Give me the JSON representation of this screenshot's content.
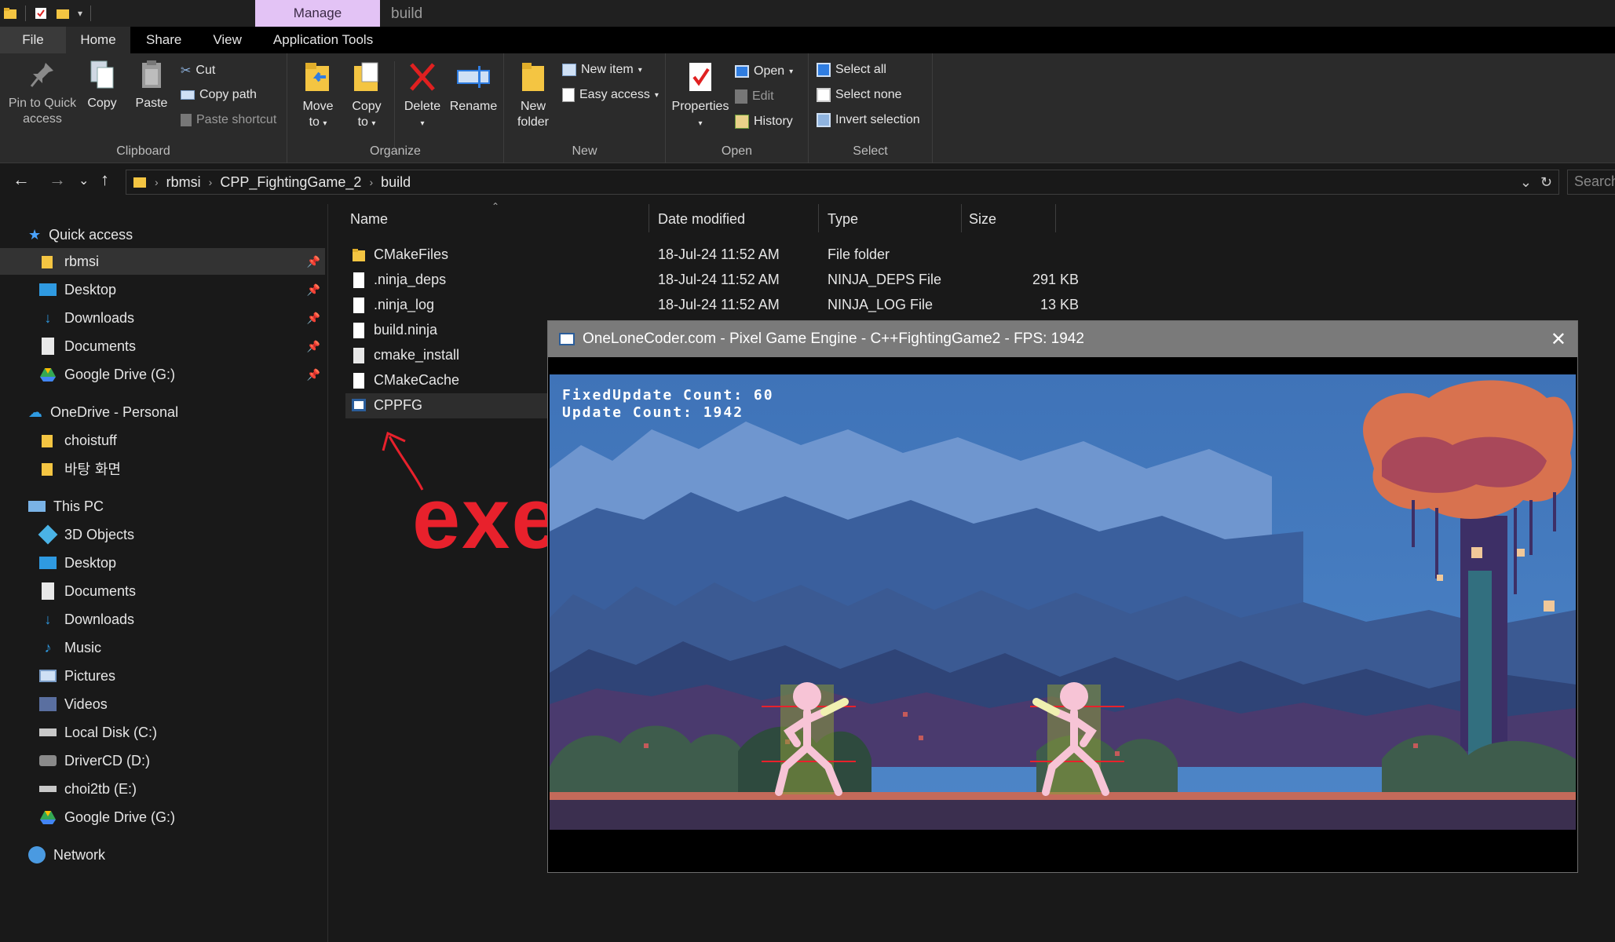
{
  "titlebar": {
    "context_tab": "Manage",
    "folder_name": "build"
  },
  "ribbon_tabs": [
    "File",
    "Home",
    "Share",
    "View",
    "Application Tools"
  ],
  "ribbon": {
    "clipboard": {
      "pin_label": "Pin to Quick access",
      "pin_line1": "Pin to Quick",
      "pin_line2": "access",
      "copy": "Copy",
      "paste": "Paste",
      "cut": "Cut",
      "copy_path": "Copy path",
      "paste_shortcut": "Paste shortcut",
      "group": "Clipboard"
    },
    "organize": {
      "move_line1": "Move",
      "move_line2": "to",
      "copy_line1": "Copy",
      "copy_line2": "to",
      "delete": "Delete",
      "rename": "Rename",
      "group": "Organize"
    },
    "new": {
      "folder_line1": "New",
      "folder_line2": "folder",
      "new_item": "New item",
      "easy_access": "Easy access",
      "group": "New"
    },
    "open": {
      "properties": "Properties",
      "open": "Open",
      "edit": "Edit",
      "history": "History",
      "group": "Open"
    },
    "select": {
      "select_all": "Select all",
      "select_none": "Select none",
      "invert": "Invert selection",
      "group": "Select"
    }
  },
  "address": {
    "crumbs": [
      "rbmsi",
      "CPP_FightingGame_2",
      "build"
    ],
    "search_placeholder": "Search"
  },
  "nav": {
    "quick_access": "Quick access",
    "qa_items": [
      "rbmsi",
      "Desktop",
      "Downloads",
      "Documents",
      "Google Drive (G:)"
    ],
    "onedrive": "OneDrive - Personal",
    "od_items": [
      "choistuff",
      "바탕 화면"
    ],
    "this_pc": "This PC",
    "pc_items": [
      "3D Objects",
      "Desktop",
      "Documents",
      "Downloads",
      "Music",
      "Pictures",
      "Videos",
      "Local Disk (C:)",
      "DriverCD (D:)",
      "choi2tb (E:)",
      "Google Drive (G:)"
    ],
    "network": "Network"
  },
  "columns": {
    "name": "Name",
    "date": "Date modified",
    "type": "Type",
    "size": "Size"
  },
  "files": [
    {
      "name": "CMakeFiles",
      "date": "18-Jul-24 11:52 AM",
      "type": "File folder",
      "size": ""
    },
    {
      "name": ".ninja_deps",
      "date": "18-Jul-24 11:52 AM",
      "type": "NINJA_DEPS File",
      "size": "291 KB"
    },
    {
      "name": ".ninja_log",
      "date": "18-Jul-24 11:52 AM",
      "type": "NINJA_LOG File",
      "size": "13 KB"
    },
    {
      "name": "build.ninja",
      "date": "",
      "type": "",
      "size": ""
    },
    {
      "name": "cmake_install",
      "date": "",
      "type": "",
      "size": ""
    },
    {
      "name": "CMakeCache",
      "date": "",
      "type": "",
      "size": ""
    },
    {
      "name": "CPPFG",
      "date": "",
      "type": "",
      "size": ""
    }
  ],
  "annotation": {
    "text": "exe",
    "color": "#e8212c"
  },
  "game": {
    "title": "OneLoneCoder.com - Pixel Game Engine - C++FightingGame2 - FPS: 1942",
    "hud_line1": "FixedUpdate Count: 60",
    "hud_line2": "Update Count: 1942"
  },
  "colors": {
    "accent_manage": "#e3c3f5",
    "folder_yellow": "#f4c542",
    "sky_blue": "#4a7fc1",
    "tree_orange": "#d8724f",
    "fighter_pink": "#f7c4d6"
  }
}
